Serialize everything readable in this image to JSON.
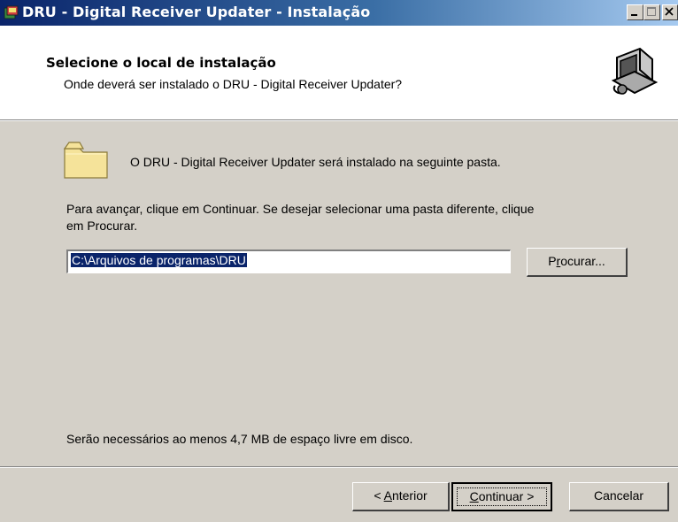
{
  "window": {
    "title": "DRU - Digital Receiver Updater - Instalação"
  },
  "header": {
    "title": "Selecione o local de instalação",
    "subtitle": "Onde deverá ser instalado o DRU - Digital Receiver Updater?"
  },
  "body": {
    "folder_message": "O DRU - Digital Receiver Updater será instalado na seguinte pasta.",
    "instruction_line1": "Para avançar, clique em Continuar. Se desejar selecionar uma pasta diferente, clique",
    "instruction_line2": "em Procurar.",
    "install_path": "C:\\Arquivos de programas\\DRU",
    "browse_button": {
      "pre": "P",
      "accel": "r",
      "post": "ocurar..."
    },
    "disk_space": "Serão necessários ao menos 4,7 MB de espaço livre em disco."
  },
  "footer": {
    "back_button": {
      "pre": "< ",
      "accel": "A",
      "post": "nterior"
    },
    "next_button": {
      "pre": "",
      "accel": "C",
      "post": "ontinuar >"
    },
    "cancel_button": "Cancelar"
  }
}
